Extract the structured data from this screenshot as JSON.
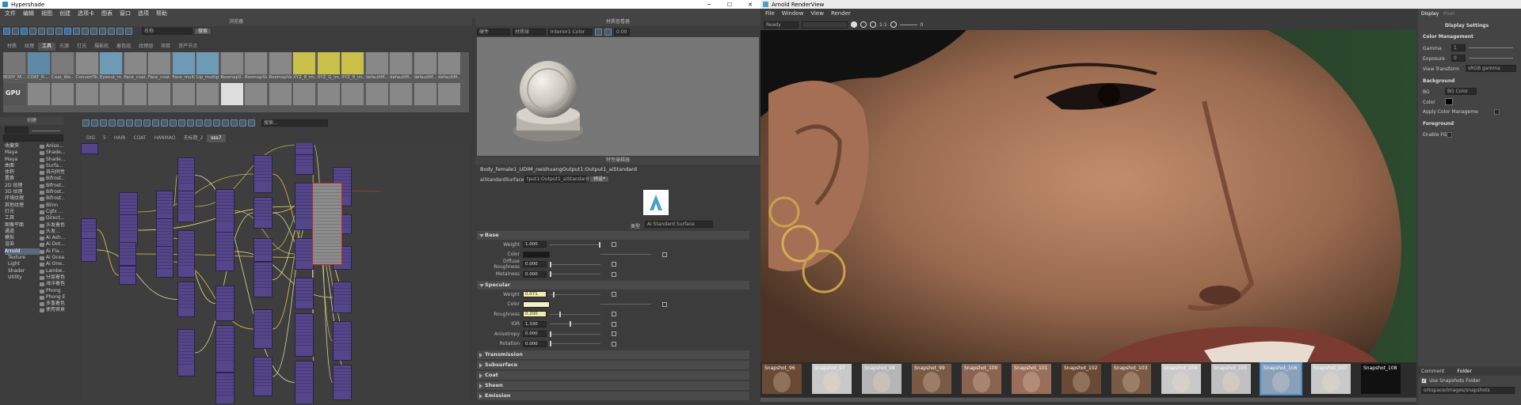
{
  "hypershade": {
    "title": "Hypershade",
    "menu": [
      "文件",
      "编辑",
      "视图",
      "创建",
      "选项卡",
      "图表",
      "窗口",
      "选项",
      "帮助"
    ],
    "browser_title": "浏览器",
    "browser_search_placeholder": "搜索",
    "browser_search_value": "名称",
    "browser_tabs": [
      "材质",
      "纹理",
      "工具",
      "光源",
      "灯光",
      "摄影机",
      "着色组",
      "纹理组",
      "项目",
      "资产节点"
    ],
    "browser_active_tab": "工具",
    "swatches_row1": [
      "BODY_M...",
      "COAT_R...",
      "Coat_Wo...",
      "ConvertTo...",
      "Eyeout_m...",
      "Face_coat...",
      "Face_coat...",
      "Face_multi...",
      "Lip_multip...",
      "RoomapV...",
      "RoomapVa...",
      "RoomapVa...",
      "XYZ_8_im...",
      "XYZ_G_im...",
      "XYZ_8_im...",
      "defaultM...",
      "defaultM...",
      "defaultM...",
      "defaultM..."
    ],
    "swatches_row2": [
      "GPU"
    ],
    "create_title": "创建",
    "tree_top": [
      "收藏夹",
      "Maya",
      "Maya",
      "曲面",
      "体积",
      "置换",
      "2D 纹理",
      "3D 纹理",
      "环境纹理",
      "其他纹理",
      "灯光",
      "工具",
      "图像平面",
      "通道",
      "模拟",
      "渲染"
    ],
    "tree_arnold": [
      "Arnold",
      "Texture",
      "Light",
      "Shader",
      "Utility"
    ],
    "create_items": [
      "Aniso...",
      "Shade...",
      "Shade...",
      "Surfa...",
      "各向同性...",
      "Bifrost...",
      "Bifrost...",
      "Bifrost...",
      "Bifrost...",
      "Blinn",
      "Cgfx ...",
      "Direct...",
      "头发着色器",
      "头发...",
      "Ai Ash...",
      "Ai Dot...",
      "Ai Fla...",
      "Ai Ocea...",
      "Ai One...",
      "Lambe...",
      "分层着色器",
      "海洋着色器",
      "Phong",
      "Phong E...",
      "多重着色...",
      "使用背景"
    ],
    "graph_tabs": [
      "DIG",
      "5",
      "HAIR",
      "COAT",
      "HANMAO",
      "无标题_2",
      "sss7"
    ],
    "graph_active_tab": "sss7",
    "graph_search_placeholder": "搜索...",
    "material_viewer_title": "材质查看器",
    "mv_renderer": "硬件",
    "mv_shape": "材质球",
    "mv_env": "Interior1 Color",
    "mv_exposure": "0.00",
    "attr_editor_title": "特性编辑器",
    "shader_path": "Body_female1_UDIM_neishuangOutput1:Output1_aiStandard",
    "surface_label": "aiStandardSurface:",
    "surface_value": "tput1:Output1_aiStandard",
    "preset_btn": "预设*",
    "type_label": "类型",
    "type_value": "Ai Standard Surface",
    "sections": {
      "base": "Base",
      "specular": "Specular",
      "transmission": "Transmission",
      "subsurface": "Subsurface",
      "coat": "Coat",
      "sheen": "Sheen",
      "emission": "Emission"
    },
    "base_attrs": [
      {
        "label": "Weight",
        "value": "1.000",
        "slider": 1.0
      },
      {
        "label": "Color",
        "value": "",
        "color": "#1a1a1a"
      },
      {
        "label": "Diffuse Roughness",
        "value": "0.000",
        "slider": 0.0
      },
      {
        "label": "Metalness",
        "value": "0.000",
        "slider": 0.0
      }
    ],
    "spec_attrs": [
      {
        "label": "Weight",
        "value": "0.071",
        "slider": 0.071,
        "hl": true
      },
      {
        "label": "Color",
        "value": "",
        "color": "#f5f1c8"
      },
      {
        "label": "Roughness",
        "value": "0.200",
        "slider": 0.2,
        "hl": true
      },
      {
        "label": "IOR",
        "value": "1.330",
        "slider": 0.4
      },
      {
        "label": "Anisotropy",
        "value": "0.000",
        "slider": 0.0
      },
      {
        "label": "Rotation",
        "value": "0.000",
        "slider": 0.0
      }
    ]
  },
  "arnold": {
    "title": "Arnold RenderView",
    "menu": [
      "File",
      "Window",
      "View",
      "Render"
    ],
    "status": "Ready",
    "ratio": "1:1",
    "exposure": "0",
    "snapshots": [
      "Snapshot_96",
      "Snapshot_97",
      "Snapshot_98",
      "Snapshot_99",
      "Snapshot_100",
      "Snapshot_101",
      "Snapshot_102",
      "Snapshot_103",
      "Snapshot_104",
      "Snapshot_105",
      "Snapshot_106",
      "Snapshot_107",
      "Snapshot_108"
    ],
    "selected_snapshot": "Snapshot_106",
    "tabs": [
      "Display",
      "Pixel"
    ],
    "active_tab": "Display",
    "panel_title": "Display Settings",
    "color_mgmt": "Color Management",
    "gamma_label": "Gamma",
    "gamma_value": "1",
    "exposure_label": "Exposure",
    "exposure_value": "0",
    "view_transform_label": "View Transform",
    "view_transform_value": "sRGB gamma",
    "background": "Background",
    "bg_label": "BG",
    "bg_value": "BG Color",
    "color_label": "Color",
    "apply_cm": "Apply Color Manageme",
    "foreground": "Foreground",
    "enable_fg": "Enable FG",
    "bottom_tabs": [
      "Comment",
      "Folder"
    ],
    "use_snap_folder": "Use Snapshots Folder",
    "snap_path": "orkspace/images/snapshots"
  },
  "colors": {
    "node": "#54468a",
    "accent": "#3b6fa3",
    "highlight": "#f3ecaa"
  }
}
